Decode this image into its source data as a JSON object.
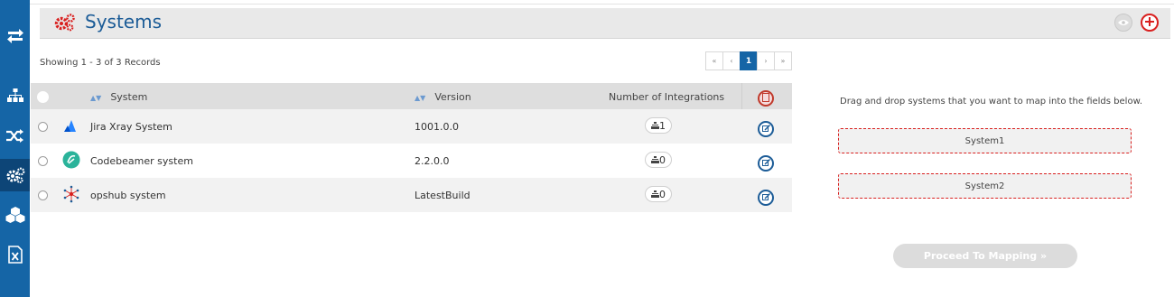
{
  "header": {
    "title": "Systems"
  },
  "records": {
    "showing_text": "Showing 1 - 3 of 3 Records"
  },
  "pager": {
    "first": "«",
    "prev": "‹",
    "current": "1",
    "next": "›",
    "last": "»"
  },
  "table": {
    "columns": {
      "system": "System",
      "version": "Version",
      "integrations": "Number of Integrations"
    },
    "rows": [
      {
        "name": "Jira Xray System",
        "version": "1001.0.0",
        "integrations": "1",
        "logo": "atlassian-logo"
      },
      {
        "name": "Codebeamer system",
        "version": "2.2.0.0",
        "integrations": "0",
        "logo": "codebeamer-logo"
      },
      {
        "name": "opshub system",
        "version": "LatestBuild",
        "integrations": "0",
        "logo": "opshub-logo"
      }
    ]
  },
  "mapping": {
    "hint": "Drag and drop systems that you want to map into the fields below.",
    "slot1": "System1",
    "slot2": "System2",
    "proceed_label": "Proceed To Mapping »"
  },
  "colors": {
    "rail": "#1565a6",
    "title": "#1c5c97",
    "accent_red": "#d9201f"
  },
  "icons": {
    "rail": [
      "sync-icon",
      "hierarchy-icon",
      "shuffle-icon",
      "gears-icon",
      "cubes-icon",
      "excel-icon"
    ]
  }
}
